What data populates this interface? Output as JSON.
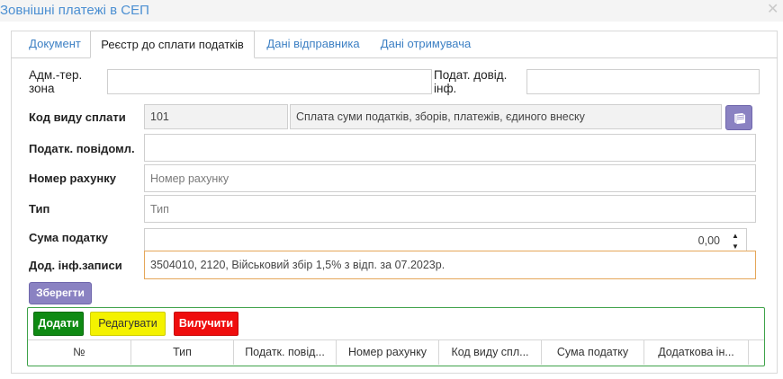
{
  "window": {
    "title": "Зовнішні платежі в СЕП",
    "close_glyph": "✕"
  },
  "tabs": [
    {
      "label": "Документ",
      "active": false
    },
    {
      "label": "Реєстр до сплати податків",
      "active": true
    },
    {
      "label": "Дані відправника",
      "active": false
    },
    {
      "label": "Дані отримувача",
      "active": false
    }
  ],
  "form": {
    "adm_zone": {
      "label_line1": "Адм.-тер.",
      "label_line2": "зона",
      "value": ""
    },
    "tax_ref": {
      "label_line1": "Подат. довід.",
      "label_line2": "інф.",
      "value": ""
    },
    "payment_code": {
      "label": "Код виду сплати",
      "code": "101",
      "description": "Сплата суми податків, зборів, платежів, єдиного внеску",
      "lookup_icon": "book-icon"
    },
    "tax_notice": {
      "label": "Податк. повідомл.",
      "value": ""
    },
    "account": {
      "label": "Номер рахунку",
      "value": "",
      "placeholder": "Номер рахунку"
    },
    "type": {
      "label": "Тип",
      "value": "",
      "placeholder": "Тип"
    },
    "tax_amount": {
      "label": "Сума податку",
      "value": "0,00",
      "up": "▲",
      "down": "▼"
    },
    "extra_info": {
      "label": "Дод. інф.записи",
      "value": "3504010, 2120, Військовий збір 1,5% з відп. за 07.2023р."
    },
    "save_label": "Зберегти"
  },
  "grid": {
    "add_label": "Додати",
    "edit_label": "Редагувати",
    "delete_label": "Вилучити",
    "columns": [
      "№",
      "Тип",
      "Податк. повід...",
      "Номер рахунку",
      "Код виду спл...",
      "Сума податку",
      "Додаткова ін..."
    ],
    "rows": []
  },
  "colors": {
    "accent_blue": "#4b8fd2",
    "save_button": "#8a82c2",
    "add_button": "#0f8a13",
    "edit_button": "#f4f200",
    "delete_button": "#ef0d0d",
    "grid_border": "#3fa24a"
  }
}
